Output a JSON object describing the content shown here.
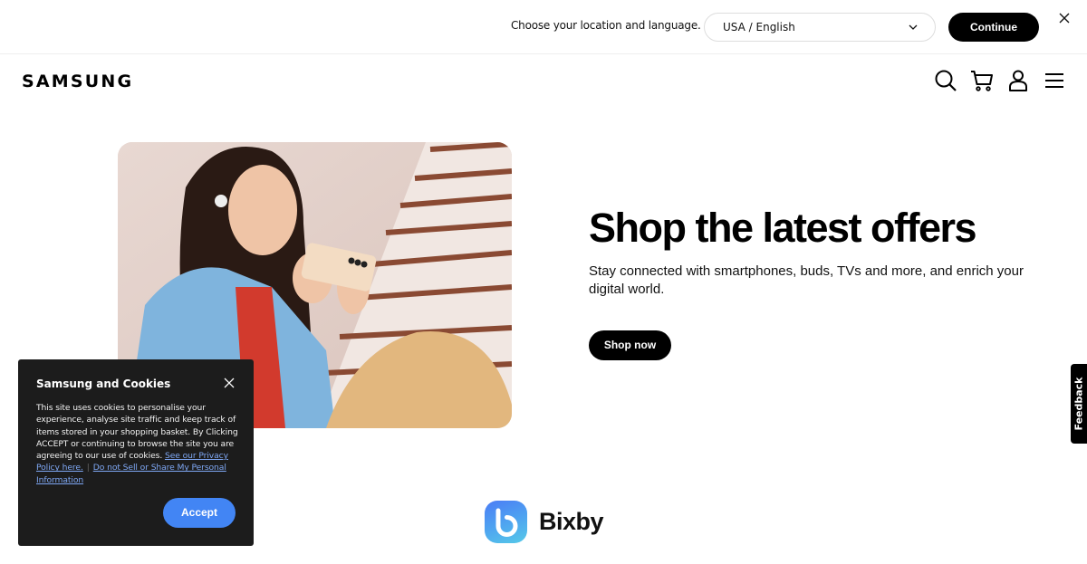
{
  "location_bar": {
    "prompt": "Choose your location and language.",
    "selected_location": "USA / English",
    "continue_label": "Continue"
  },
  "header": {
    "logo": "SAMSUNG",
    "icons": [
      "search-icon",
      "cart-icon",
      "user-icon",
      "menu-icon"
    ]
  },
  "hero": {
    "title": "Shop the latest offers",
    "subtitle": "Stay connected with smartphones, buds, TVs and more, and enrich your digital world.",
    "cta_label": "Shop now",
    "image_alt": "Woman sitting on stairs wearing earbuds, holding a smartphone"
  },
  "bixby": {
    "label": "Bixby"
  },
  "feedback": {
    "label": "Feedback"
  },
  "cookie_banner": {
    "title": "Samsung and Cookies",
    "body": "This site uses cookies to personalise your experience, analyse site traffic and keep track of items stored in your shopping basket. By Clicking ACCEPT or continuing to browse the site you are agreeing to our use of cookies.",
    "privacy_link": "See our Privacy Policy here.",
    "separator": "|",
    "do_not_sell_link": "Do not Sell or Share My Personal Information",
    "accept_label": "Accept"
  },
  "colors": {
    "accent_blue": "#4285f4",
    "link_blue": "#7fa8f5",
    "black": "#000000",
    "modal_bg": "#1c1c1c"
  }
}
